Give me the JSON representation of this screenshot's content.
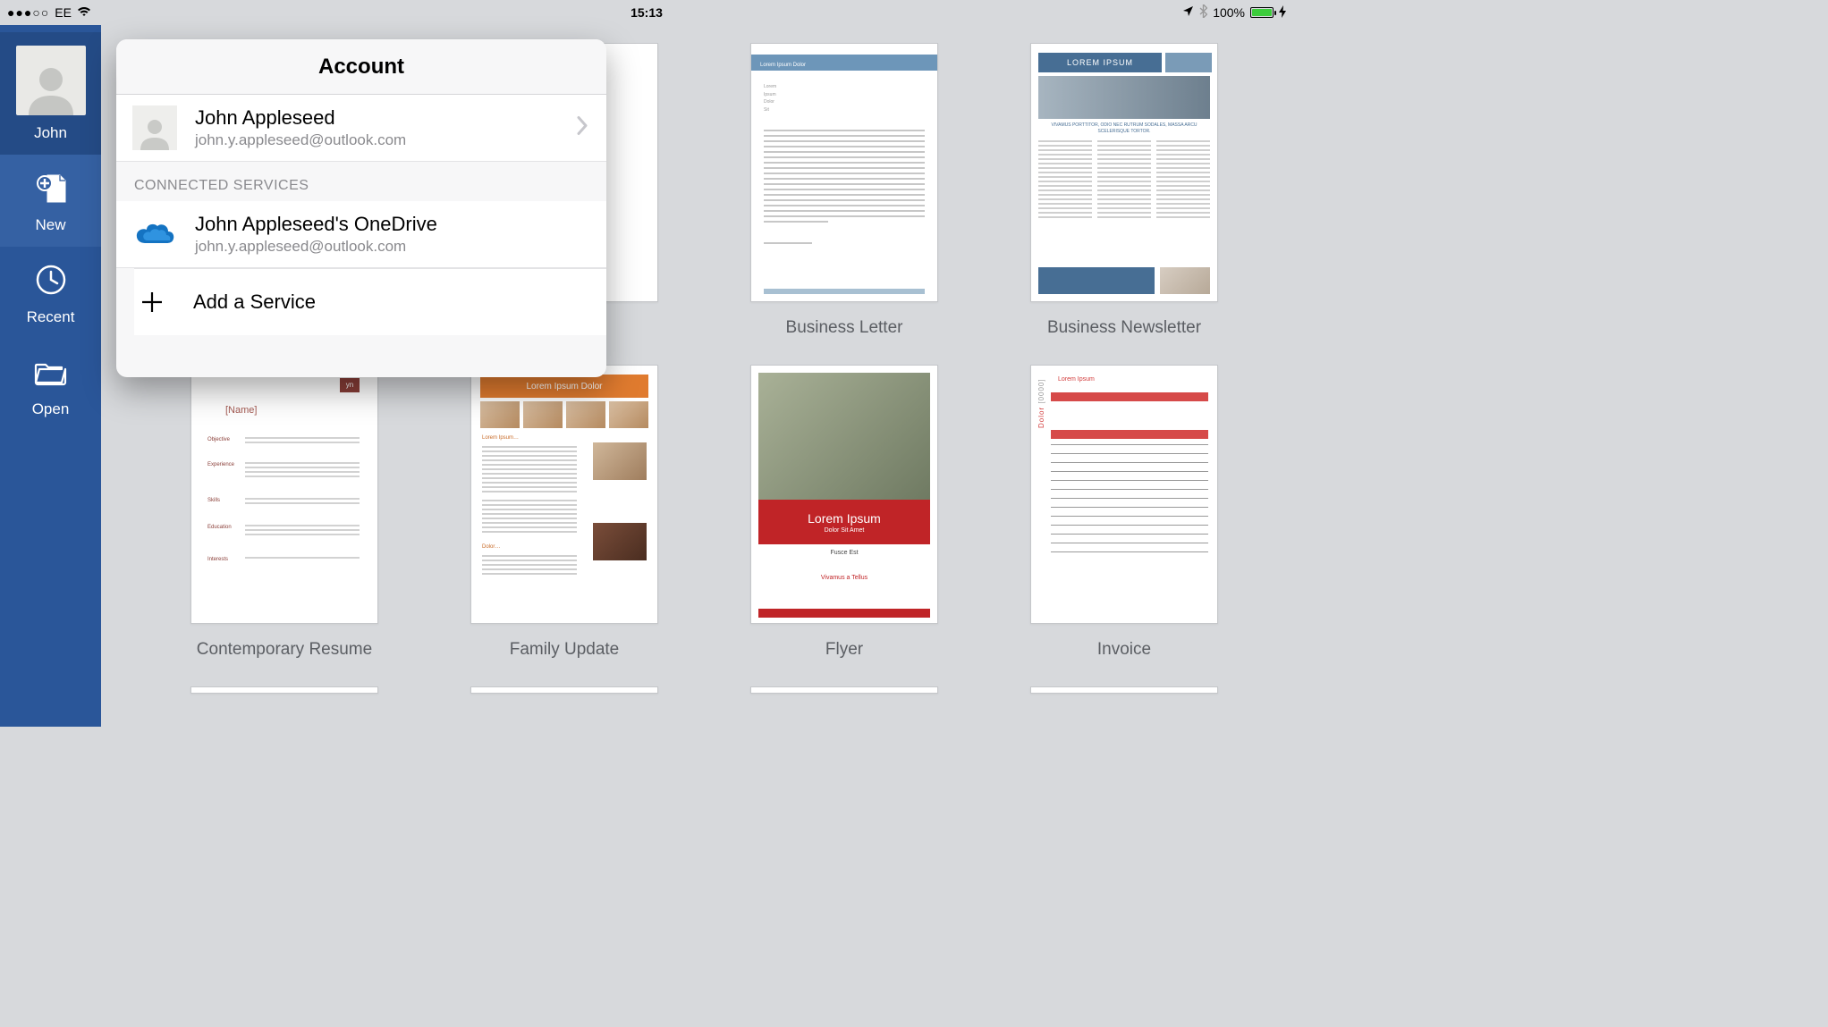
{
  "statusbar": {
    "signal_dots": "●●●○○",
    "carrier": "EE",
    "time": "15:13",
    "battery_pct": "100%"
  },
  "sidebar": {
    "user_label": "John",
    "new_label": "New",
    "recent_label": "Recent",
    "open_label": "Open"
  },
  "popover": {
    "title": "Account",
    "account": {
      "name": "John Appleseed",
      "email": "john.y.appleseed@outlook.com"
    },
    "section_connected": "CONNECTED SERVICES",
    "service": {
      "name": "John Appleseed's OneDrive",
      "email": "john.y.appleseed@outlook.com"
    },
    "add_service": "Add a Service"
  },
  "templates": {
    "row1": [
      {
        "caption": "",
        "hidden_by_popover": true
      },
      {
        "caption": "",
        "hidden_by_popover": true
      },
      {
        "caption": "Business Letter"
      },
      {
        "caption": "Business Newsletter"
      }
    ],
    "row2": [
      {
        "caption": "Contemporary Resume"
      },
      {
        "caption": "Family Update"
      },
      {
        "caption": "Flyer"
      },
      {
        "caption": "Invoice"
      }
    ]
  },
  "thumb_text": {
    "news_title": "LOREM IPSUM",
    "news_sub": "VIVAMUS PORTTITOR, ODIO NEC RUTRUM SODALES, MASSA ARCU SCELERISQUE TORTOR.",
    "resume_name": "[Name]",
    "resume_logo": "yn",
    "family_hdr": "Lorem Ipsum Dolor",
    "family_s1": "Lorem Ipsum…",
    "family_s2": "Dolor…",
    "flyer_t1": "Lorem Ipsum",
    "flyer_t2": "Dolor Sit Amet",
    "flyer_s1": "Fusce Est",
    "flyer_s2": "Vivamus a Tellus",
    "invoice_side": "Dolor",
    "invoice_code": "[0000]",
    "invoice_hdr": "Lorem Ipsum",
    "letter_title": "Lorem Ipsum Dolor"
  }
}
